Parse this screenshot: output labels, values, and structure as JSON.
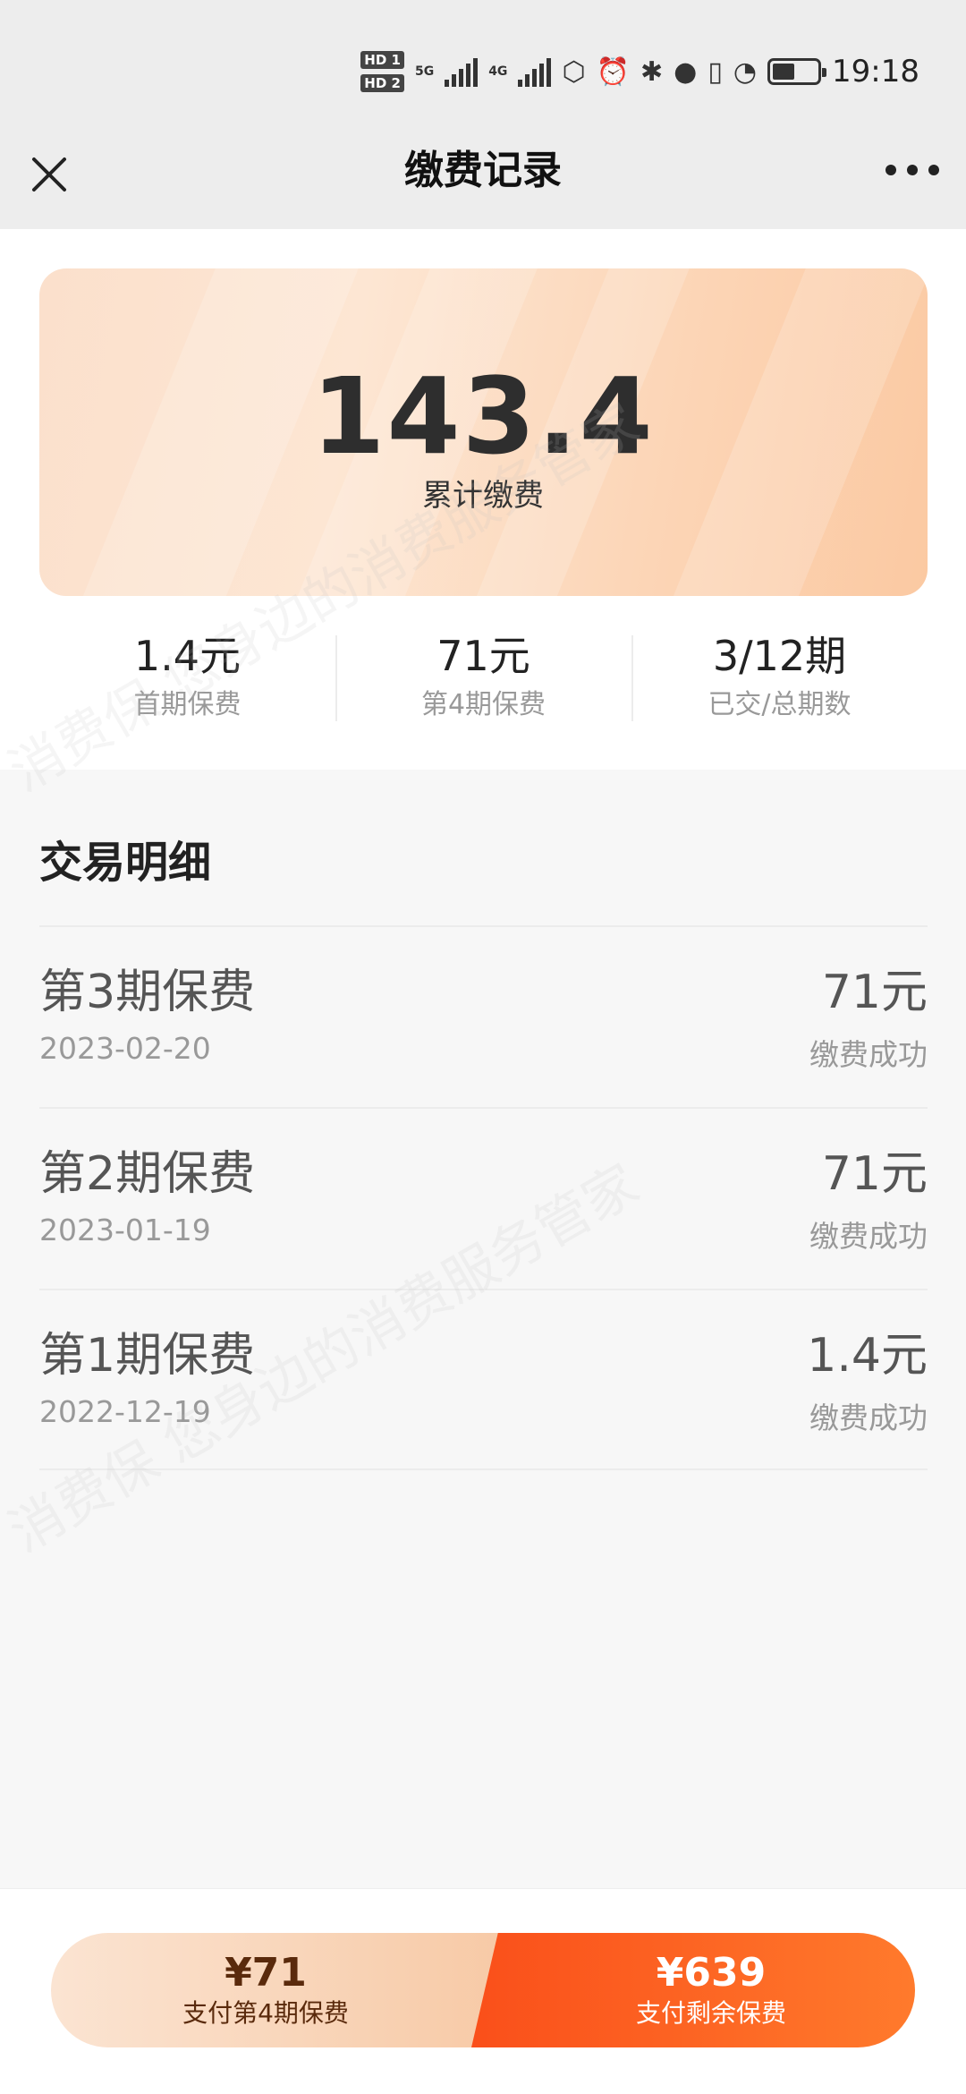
{
  "status_bar": {
    "sim1": "HD 1",
    "sim2": "HD 2",
    "net1": "5G",
    "net2": "4G",
    "time": "19:18"
  },
  "header": {
    "title": "缴费记录",
    "close_icon": "close-icon",
    "more_icon": "more-icon"
  },
  "summary": {
    "total_amount": "143.4",
    "total_label": "累计缴费",
    "stats": [
      {
        "value": "1.4元",
        "label": "首期保费"
      },
      {
        "value": "71元",
        "label": "第4期保费"
      },
      {
        "value": "3/12期",
        "label": "已交/总期数"
      }
    ]
  },
  "transactions": {
    "title": "交易明细",
    "items": [
      {
        "title": "第3期保费",
        "date": "2023-02-20",
        "amount": "71元",
        "status": "缴费成功"
      },
      {
        "title": "第2期保费",
        "date": "2023-01-19",
        "amount": "71元",
        "status": "缴费成功"
      },
      {
        "title": "第1期保费",
        "date": "2022-12-19",
        "amount": "1.4元",
        "status": "缴费成功"
      }
    ]
  },
  "watermark": {
    "text1": "消费保 您身边的消费服务管家"
  },
  "footer": {
    "pay_next_amount": "¥71",
    "pay_next_label": "支付第4期保费",
    "pay_rest_amount": "¥639",
    "pay_rest_label": "支付剩余保费"
  },
  "colors": {
    "accent": "#fa4f1a",
    "accent_light": "#f7c9a5",
    "background": "#f7f7f7"
  }
}
